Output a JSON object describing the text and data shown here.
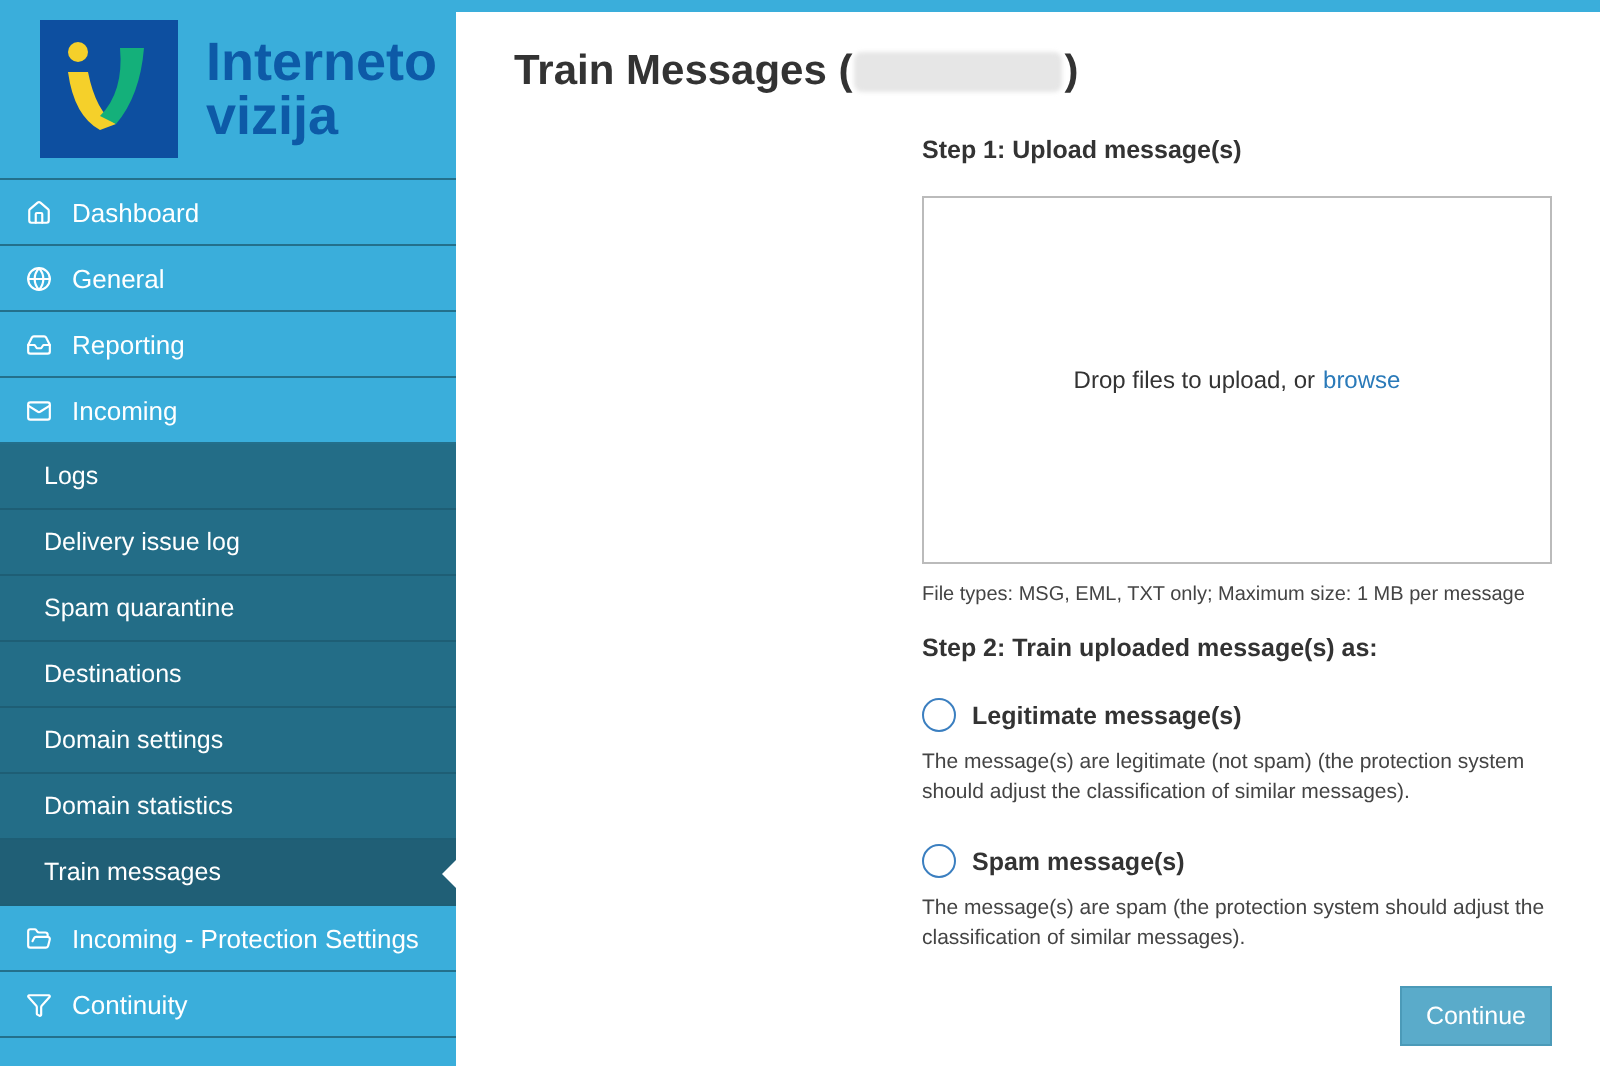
{
  "logo": {
    "line_1": "Interneto",
    "line_2": "vizija"
  },
  "menu": [
    {
      "label": "Dashboard"
    },
    {
      "label": "General"
    },
    {
      "label": "Reporting"
    },
    {
      "label": "Incoming",
      "children": [
        {
          "label": "Logs",
          "selected": false
        },
        {
          "label": "Delivery issue log",
          "selected": false
        },
        {
          "label": "Spam quarantine",
          "selected": false
        },
        {
          "label": "Destinations",
          "selected": false
        },
        {
          "label": "Domain settings",
          "selected": false
        },
        {
          "label": "Domain statistics",
          "selected": false
        },
        {
          "label": "Train messages",
          "selected": true
        }
      ]
    },
    {
      "label": "Incoming - Protection Settings"
    },
    {
      "label": "Continuity"
    }
  ],
  "title": {
    "prefix": "Train Messages (",
    "suffix": ")"
  },
  "step_1": {
    "heading": "Step 1: Upload message(s)",
    "drop_text": "Drop files to upload, or",
    "browse_link": "browse",
    "hint": "File types: MSG, EML, TXT only; Maximum size: 1 MB per message"
  },
  "step_2": {
    "heading": "Step 2: Train uploaded message(s) as:",
    "options": [
      {
        "label": "Legitimate message(s)",
        "checked": false,
        "description": "The message(s) are legitimate (not spam) (the protection system should adjust the classification of similar messages)."
      },
      {
        "label": "Spam message(s)",
        "checked": false,
        "description": "The message(s) are spam (the protection system should adjust the classification of similar messages)."
      }
    ]
  },
  "continue_button": "Continue"
}
